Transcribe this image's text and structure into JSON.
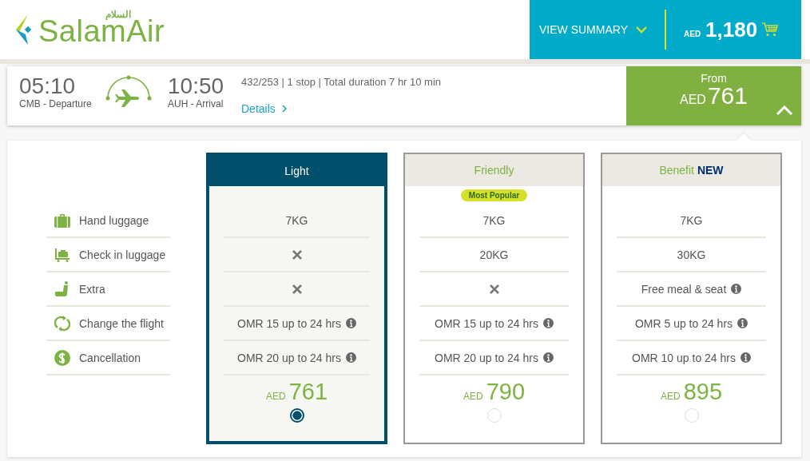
{
  "logo": {
    "arabic": "السلام",
    "name": "SalamAir"
  },
  "summary": {
    "label": "VIEW SUMMARY",
    "currency": "AED",
    "total": "1,180"
  },
  "flight": {
    "depart_time": "05:10",
    "depart_label": "CMB - Departure",
    "arrive_time": "10:50",
    "arrive_label": "AUH - Arrival",
    "info": "432/253 | 1 stop | Total duration 7 hr 10 min",
    "details": "Details",
    "from_label": "From",
    "from_currency": "AED",
    "from_price": "761",
    "expanded": true
  },
  "features": [
    "Hand luggage",
    "Check in luggage",
    "Extra",
    "Change the flight",
    "Cancellation"
  ],
  "fares": [
    {
      "name": "Light",
      "selected": true,
      "cells": [
        {
          "kind": "text",
          "text": "7KG",
          "info": false
        },
        {
          "kind": "cross"
        },
        {
          "kind": "cross"
        },
        {
          "kind": "text",
          "text": "OMR 15 up to 24 hrs",
          "info": true
        },
        {
          "kind": "text",
          "text": "OMR 20 up to 24 hrs",
          "info": true
        }
      ],
      "currency": "AED",
      "price": "761"
    },
    {
      "name": "Friendly",
      "badge": "Most Popular",
      "selected": false,
      "cells": [
        {
          "kind": "text",
          "text": "7KG",
          "info": false
        },
        {
          "kind": "text",
          "text": "20KG",
          "info": false
        },
        {
          "kind": "cross"
        },
        {
          "kind": "text",
          "text": "OMR 15 up to 24 hrs",
          "info": true
        },
        {
          "kind": "text",
          "text": "OMR 20 up to 24 hrs",
          "info": true
        }
      ],
      "currency": "AED",
      "price": "790"
    },
    {
      "name": "Benefit **NEW**",
      "selected": false,
      "cells": [
        {
          "kind": "text",
          "text": "7KG",
          "info": false
        },
        {
          "kind": "text",
          "text": "30KG",
          "info": false
        },
        {
          "kind": "text",
          "text": "Free meal & seat",
          "info": true
        },
        {
          "kind": "text",
          "text": "OMR 5 up to 24 hrs",
          "info": true
        },
        {
          "kind": "text",
          "text": "OMR 10 up to 24 hrs",
          "info": true
        }
      ],
      "currency": "AED",
      "price": "895"
    }
  ]
}
